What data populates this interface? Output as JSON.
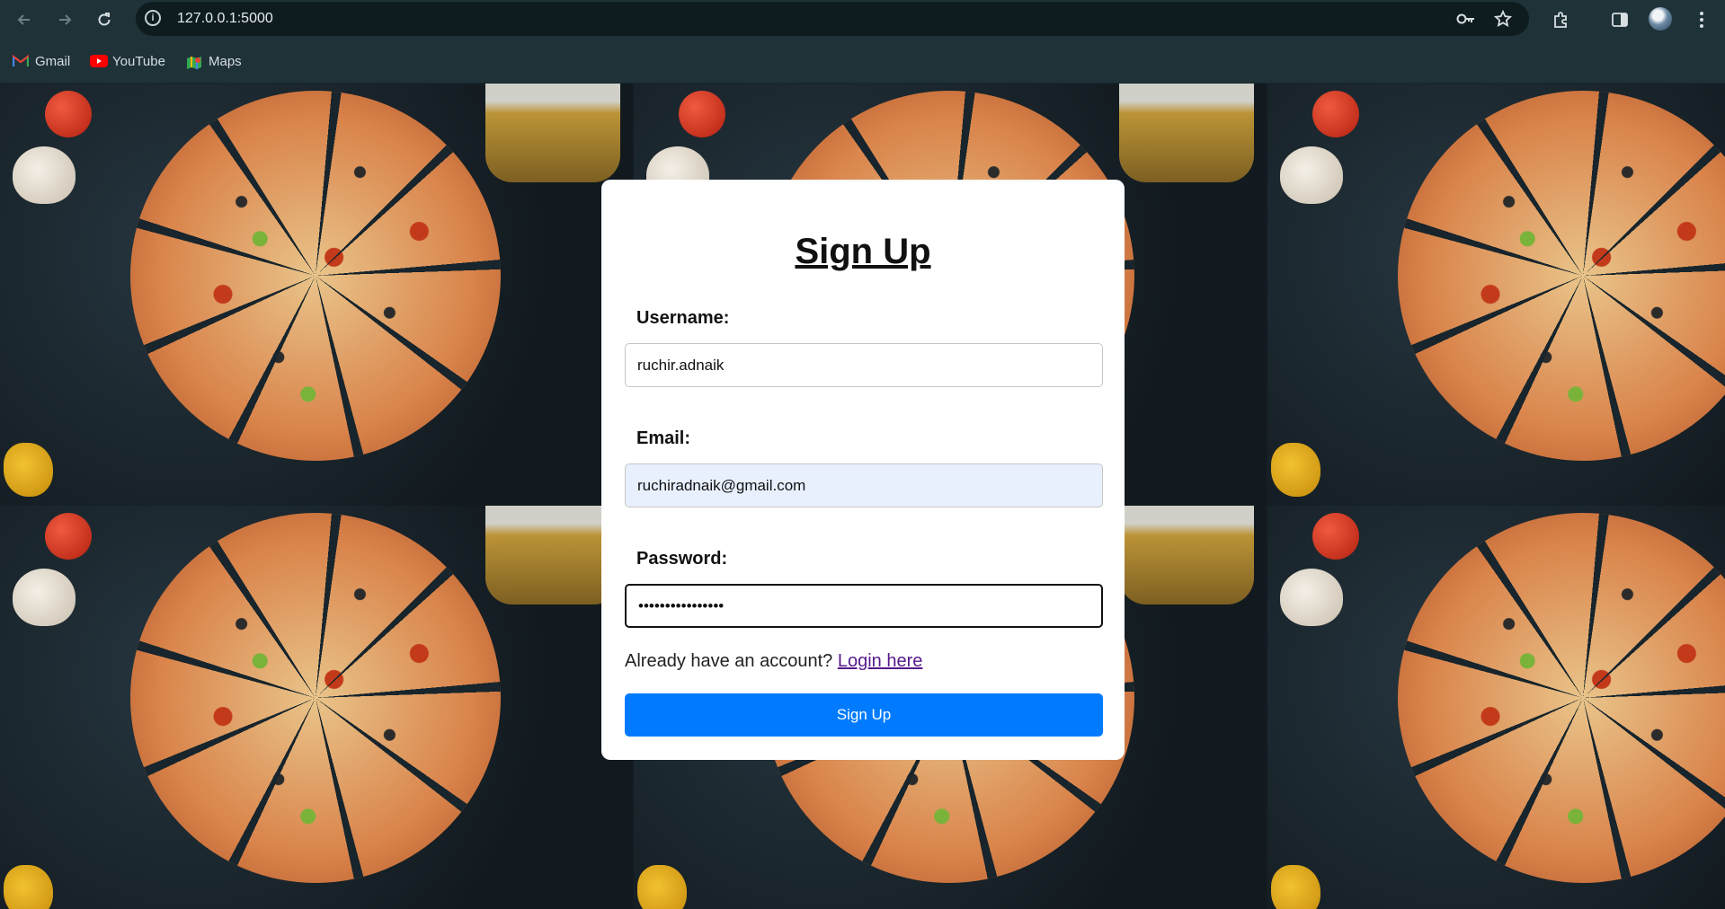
{
  "browser": {
    "url": "127.0.0.1:5000",
    "bookmarks": [
      {
        "label": "Gmail",
        "icon": "gmail-icon"
      },
      {
        "label": "YouTube",
        "icon": "youtube-icon"
      },
      {
        "label": "Maps",
        "icon": "maps-icon"
      }
    ]
  },
  "form": {
    "title": "Sign Up",
    "username_label": "Username:",
    "username_value": "ruchir.adnaik",
    "email_label": "Email:",
    "email_value": "ruchiradnaik@gmail.com",
    "password_label": "Password:",
    "password_value": "••••••••••••••••",
    "login_prompt": "Already have an account?",
    "login_link": "Login here",
    "submit_label": "Sign Up"
  },
  "colors": {
    "primary_button": "#007bff",
    "link_visited": "#551a8b",
    "autofill_bg": "#e8f0fe",
    "browser_chrome": "#1f3238"
  }
}
